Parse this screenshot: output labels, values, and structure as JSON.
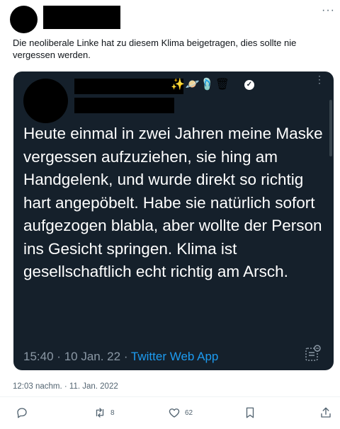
{
  "tweet": {
    "text": "Die neoliberale Linke hat zu diesem Klima beigetragen, dies sollte nie vergessen werden.",
    "timestamp": "12:03 nachm. · 11. Jan. 2022",
    "more_label": "···"
  },
  "quote": {
    "emojis": "✨🪐🩴🗑",
    "verified_mark": "✓",
    "more_label": "⋮",
    "text": "Heute einmal in zwei Jahren meine Maske vergessen aufzuziehen, sie hing am Handgelenk, und wurde direkt so richtig hart angepöbelt. Habe sie natürlich sofort aufgezogen blabla, aber wollte der Person ins Gesicht springen. Klima ist gesellschaftlich echt richtig am Arsch.",
    "time": "15:40",
    "date": "10 Jan. 22",
    "separator": "·",
    "app": "Twitter Web App"
  },
  "actions": {
    "reply_count": "",
    "retweet_count": "8",
    "like_count": "62"
  },
  "colors": {
    "quote_bg": "#15202b",
    "link_blue": "#1d9bf0",
    "muted": "#536471"
  },
  "icons": [
    "more-icon",
    "sparkles-icon",
    "planet-icon",
    "sandals-icon",
    "trash-icon",
    "verified-icon",
    "reply-icon",
    "retweet-icon",
    "like-icon",
    "bookmark-icon",
    "share-icon",
    "notes-icon"
  ]
}
